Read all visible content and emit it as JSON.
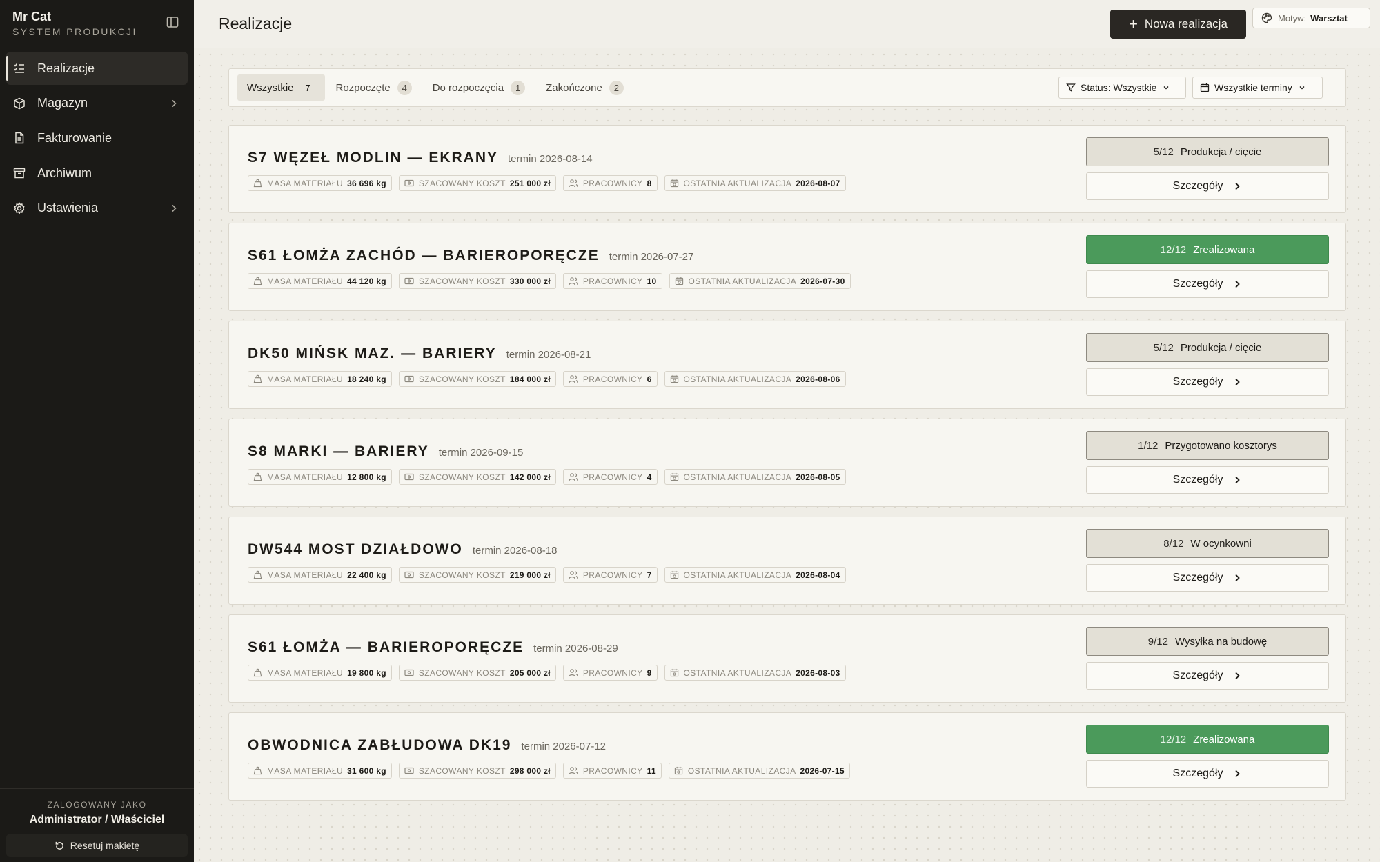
{
  "sidebar": {
    "brand": "Mr Cat",
    "subtitle": "SYSTEM PRODUKCJI",
    "items": [
      {
        "label": "Realizacje",
        "icon": "list-check-icon",
        "active": true
      },
      {
        "label": "Magazyn",
        "icon": "package-icon",
        "chevron": true
      },
      {
        "label": "Fakturowanie",
        "icon": "invoice-icon"
      },
      {
        "label": "Archiwum",
        "icon": "archive-icon"
      },
      {
        "label": "Ustawienia",
        "icon": "gear-icon",
        "chevron": true
      }
    ],
    "footer": {
      "caption": "ZALOGOWANY JAKO",
      "user": "Administrator / Właściciel",
      "reset_label": "Resetuj makietę"
    }
  },
  "header": {
    "title": "Realizacje",
    "new_button": "Nowa realizacja",
    "theme_label": "Motyw:",
    "theme_value": "Warsztat"
  },
  "filters": {
    "tabs": [
      {
        "label": "Wszystkie",
        "count": "7",
        "active": true
      },
      {
        "label": "Rozpoczęte",
        "count": "4"
      },
      {
        "label": "Do rozpoczęcia",
        "count": "1"
      },
      {
        "label": "Zakończone",
        "count": "2"
      }
    ],
    "status_dropdown": "Status: Wszystkie",
    "terms_dropdown": "Wszystkie terminy"
  },
  "labels": {
    "mass": "MASA MATERIAŁU",
    "cost": "SZACOWANY KOSZT",
    "workers": "PRACOWNICY",
    "updated": "OSTATNIA AKTUALIZACJA",
    "details": "Szczegóły"
  },
  "colors": {
    "sidebar_bg": "#1b1a17",
    "accent_dark": "#2a2723",
    "status_done": "#4b9a5b",
    "status_pending": "#e3e0d6"
  },
  "projects": [
    {
      "name": "S7 WĘZEŁ MODLIN — EKRANY",
      "term": "termin 2026-08-14",
      "mass": "36 696 kg",
      "cost": "251 000 zł",
      "workers": "8",
      "updated": "2026-08-07",
      "progress": "5/12",
      "status": "Produkcja / cięcie",
      "done": false
    },
    {
      "name": "S61 ŁOMŻA ZACHÓD — BARIEROPORĘCZE",
      "term": "termin 2026-07-27",
      "mass": "44 120 kg",
      "cost": "330 000 zł",
      "workers": "10",
      "updated": "2026-07-30",
      "progress": "12/12",
      "status": "Zrealizowana",
      "done": true
    },
    {
      "name": "DK50 MIŃSK MAZ. — BARIERY",
      "term": "termin 2026-08-21",
      "mass": "18 240 kg",
      "cost": "184 000 zł",
      "workers": "6",
      "updated": "2026-08-06",
      "progress": "5/12",
      "status": "Produkcja / cięcie",
      "done": false
    },
    {
      "name": "S8 MARKI — BARIERY",
      "term": "termin 2026-09-15",
      "mass": "12 800 kg",
      "cost": "142 000 zł",
      "workers": "4",
      "updated": "2026-08-05",
      "progress": "1/12",
      "status": "Przygotowano kosztorys",
      "done": false
    },
    {
      "name": "DW544 MOST DZIAŁDOWO",
      "term": "termin 2026-08-18",
      "mass": "22 400 kg",
      "cost": "219 000 zł",
      "workers": "7",
      "updated": "2026-08-04",
      "progress": "8/12",
      "status": "W ocynkowni",
      "done": false
    },
    {
      "name": "S61 ŁOMŻA — BARIEROPORĘCZE",
      "term": "termin 2026-08-29",
      "mass": "19 800 kg",
      "cost": "205 000 zł",
      "workers": "9",
      "updated": "2026-08-03",
      "progress": "9/12",
      "status": "Wysyłka na budowę",
      "done": false
    },
    {
      "name": "OBWODNICA ZABŁUDOWA DK19",
      "term": "termin 2026-07-12",
      "mass": "31 600 kg",
      "cost": "298 000 zł",
      "workers": "11",
      "updated": "2026-07-15",
      "progress": "12/12",
      "status": "Zrealizowana",
      "done": true
    }
  ]
}
